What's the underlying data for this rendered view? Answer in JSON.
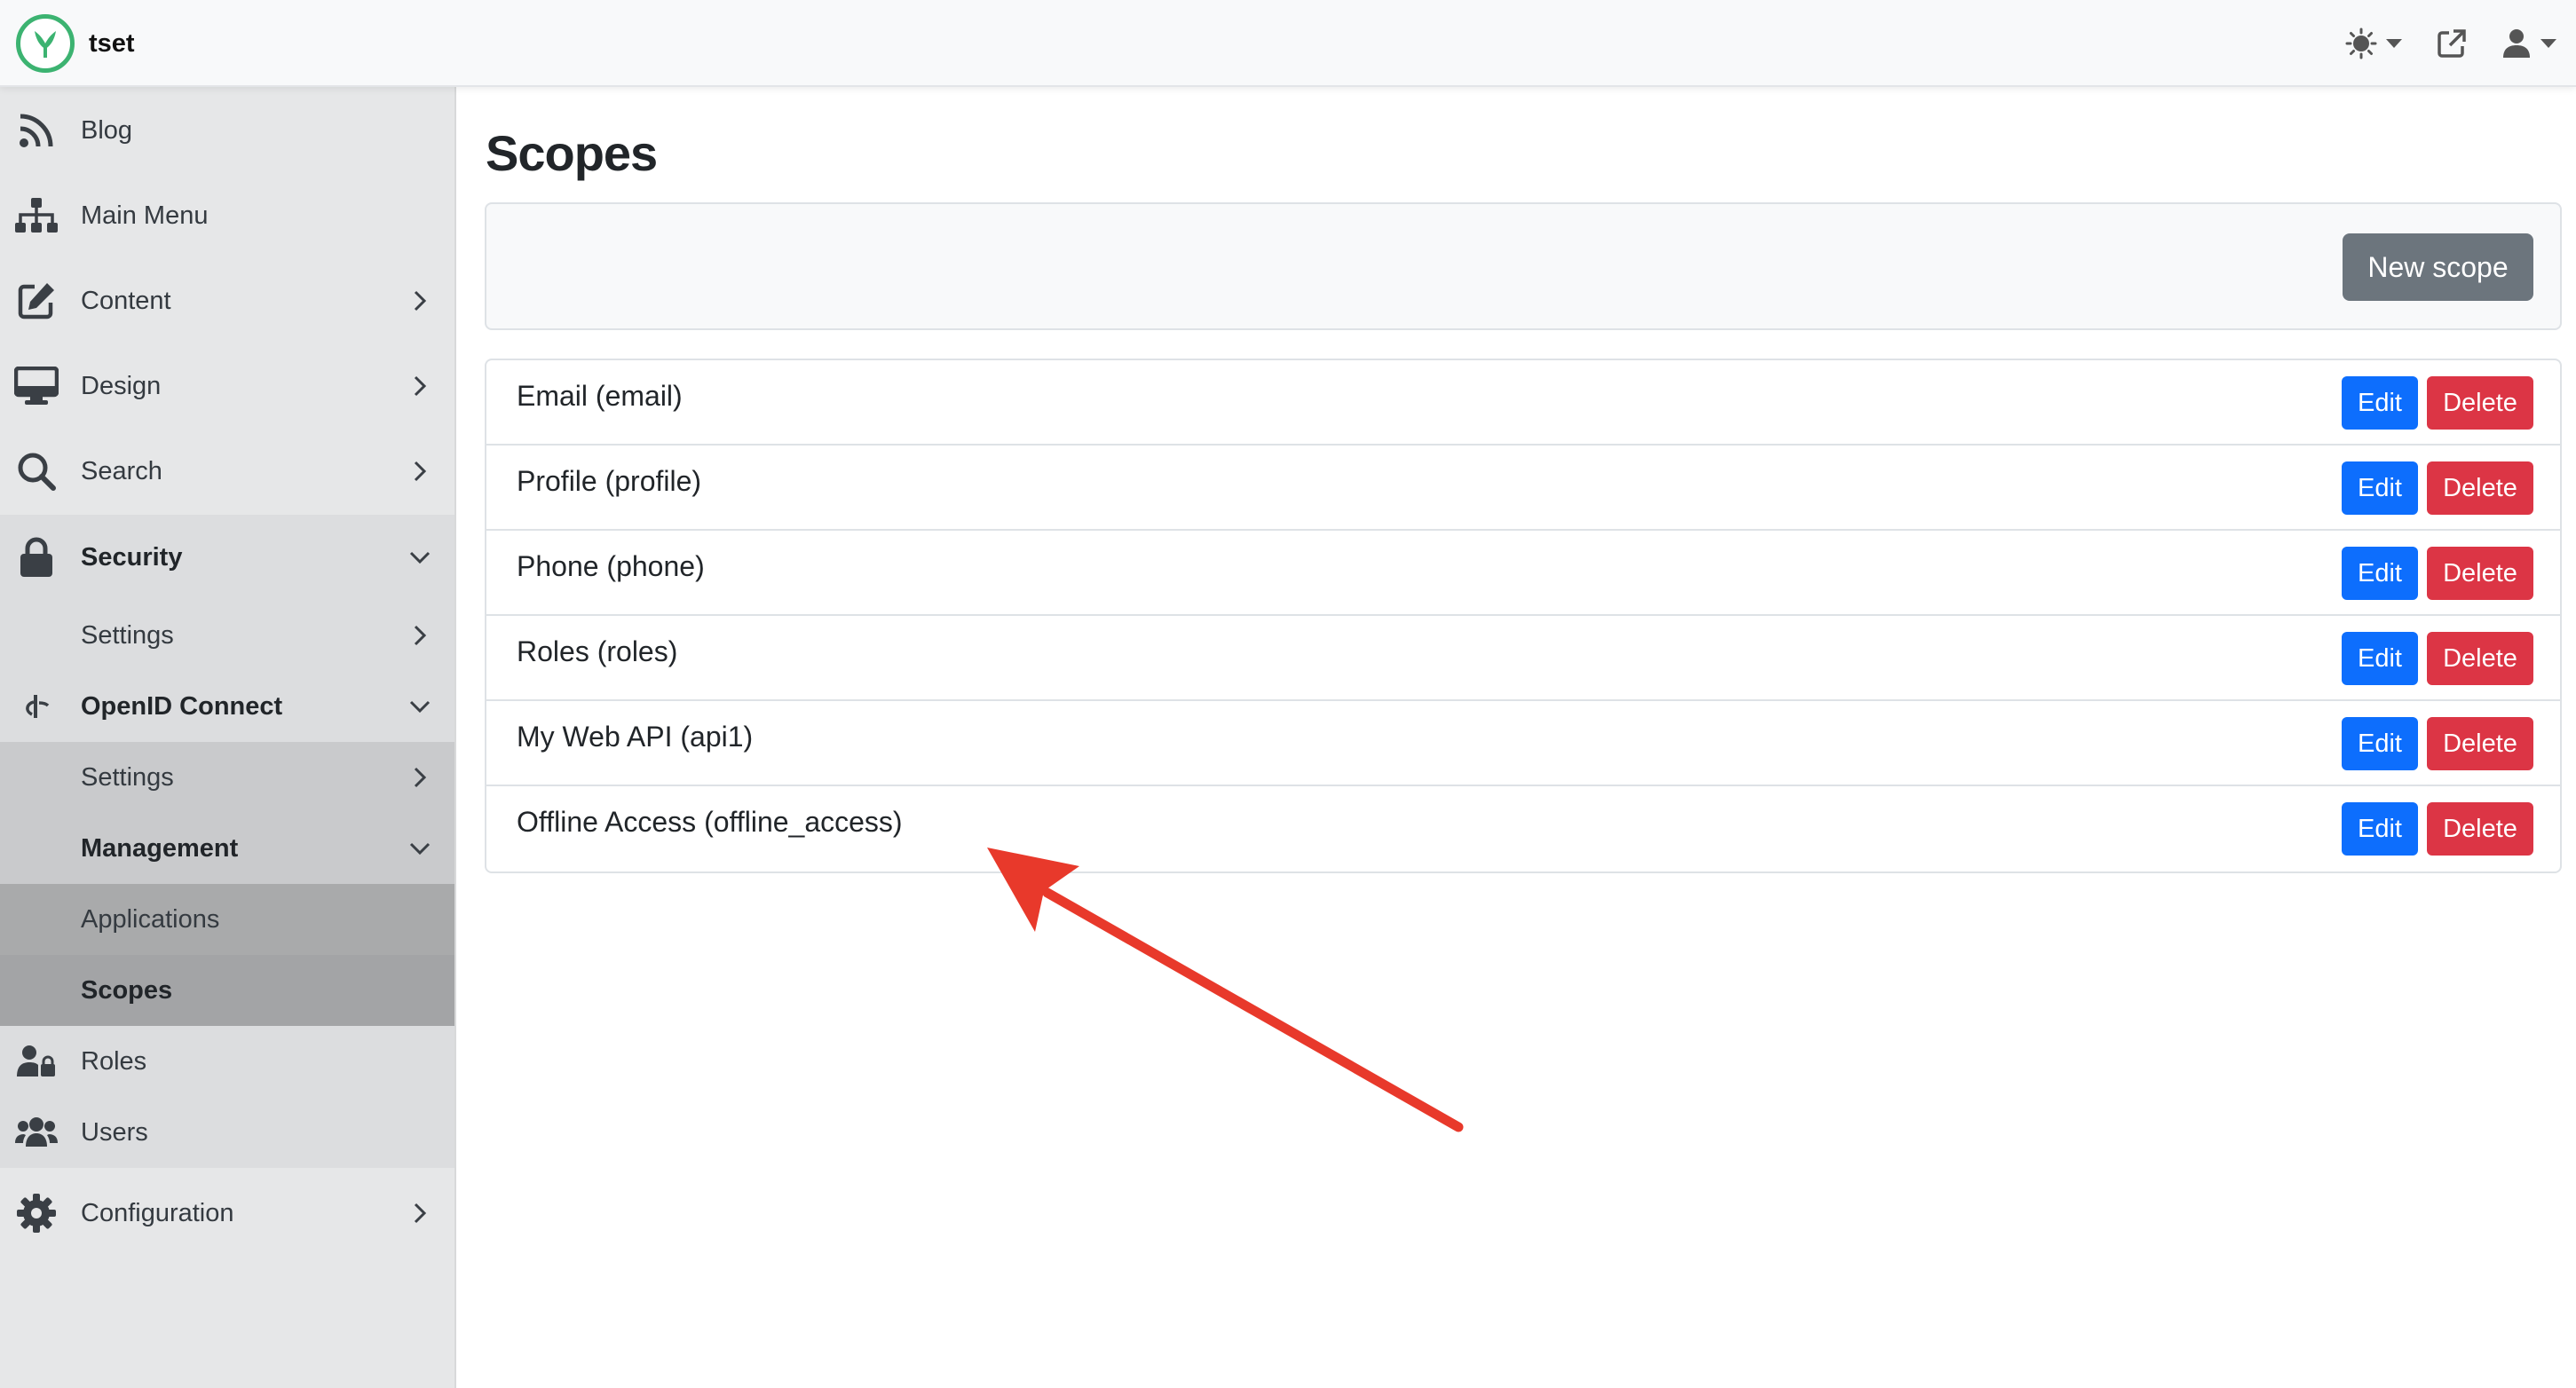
{
  "app": {
    "title": "tset"
  },
  "topbar": {
    "icons": [
      "theme-sun-icon",
      "external-link-icon",
      "user-icon"
    ]
  },
  "sidebar": {
    "items": [
      {
        "label": "Blog",
        "icon": "rss-icon"
      },
      {
        "label": "Main Menu",
        "icon": "sitemap-icon"
      },
      {
        "label": "Content",
        "icon": "edit-icon"
      },
      {
        "label": "Design",
        "icon": "desktop-icon"
      },
      {
        "label": "Search",
        "icon": "search-icon"
      },
      {
        "label": "Security",
        "icon": "lock-icon"
      },
      {
        "label": "Settings"
      },
      {
        "label": "OpenID Connect",
        "icon": "openid-icon"
      },
      {
        "label": "Settings"
      },
      {
        "label": "Management"
      },
      {
        "label": "Applications"
      },
      {
        "label": "Scopes"
      },
      {
        "label": "Roles",
        "icon": "user-lock-icon"
      },
      {
        "label": "Users",
        "icon": "users-icon"
      },
      {
        "label": "Configuration",
        "icon": "gear-icon"
      }
    ]
  },
  "main": {
    "title": "Scopes",
    "new_button": "New scope",
    "edit_label": "Edit",
    "delete_label": "Delete",
    "scopes": [
      "Email (email)",
      "Profile (profile)",
      "Phone (phone)",
      "Roles (roles)",
      "My Web API (api1)",
      "Offline Access (offline_access)"
    ]
  },
  "colors": {
    "primary": "#0d6efd",
    "danger": "#dc3545",
    "secondary": "#6c757d",
    "annotation": "#e8392b"
  }
}
